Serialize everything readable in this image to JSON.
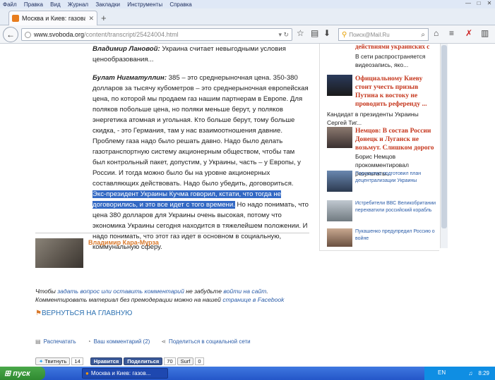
{
  "window": {
    "menu": [
      "Файл",
      "Правка",
      "Вид",
      "Журнал",
      "Закладки",
      "Инструменты",
      "Справка"
    ]
  },
  "tab": {
    "title": "Москва и Киев: газовая война ..."
  },
  "address": {
    "domain": "www.svoboda.org",
    "path": "/content/transcript/25424004.html"
  },
  "search": {
    "placeholder": "Поиск@Mail.Ru"
  },
  "article": {
    "p1_name": "Владимир Лановой:",
    "p1_text": " Украина считает невыгодными условия ценообразования...",
    "p2_name": "Булат Нигматуллин:",
    "p2_text": " 385 – это среднерыночная цена. 350-380 долларов за тысячу кубометров – это среднерыночная европейская цена, по которой мы продаем газ нашим партнерам в Европе. Для поляков побольше цена, но поляки меньше берут, у поляков энергетика атомная и угольная. Кто больше берут, тому больше скидка, - это Германия, там у нас взаимоотношения давние. Проблему газа надо было решать давно. Надо было делать газотранспортную систему акционерным обществом, чтобы там был контрольный пакет, допустим, у Украины, часть – у Европы, у России. И тогда можно было бы на уровне акционерных составляющих действовать. Надо было убедить, договориться.",
    "p2_highlight": " Экс-президент Украины Кучма говорил, кстати, что тогда не договорились, и это все идет с того времени.",
    "p2_tail": " Но надо понимать, что цена 380 долларов для Украины очень высокая, потому что экономика Украины сегодня находится в тяжелейшем положении. И надо понимать, что этот газ идет в основном в социальную, коммунальную сферу.",
    "author": "Владимир Кара-Мурза"
  },
  "note": {
    "t1": "Чтобы ",
    "l1": "задать вопрос или оставить комментарий",
    "t2": " не забудьте ",
    "l2": "войти на сайт",
    "t3": ".",
    "t4": "Комментировать материал без премодерации можно на нашей ",
    "l3": "странице в Facebook"
  },
  "back_link": "ВЕРНУТЬСЯ НА ГЛАВНУЮ",
  "actions": [
    "Распечатать",
    "Ваш комментарий (2)",
    "Поделиться в социальной сети"
  ],
  "sidebar": {
    "top_title": "действиями украинских с",
    "top_text": "В сети распространяется видеозапись, яко...",
    "item1_title": "Официальному Киеву стоит учесть призыв Путина к востоку не проводить референду ...",
    "item1_text": "Кандидат в президенты Украины Сергей Тиг...",
    "item2_title": "Немцов: В состав России Донецк и Луганск не возьмут. Слишком дорого",
    "item2_text": "Борис Немцов прокомментировал результаты...",
    "small1": "Порошенко подготовил план децентрализации Украины",
    "small2": "Истребители ВВС Великобритании перехватили российский корабль",
    "small3": "Пукашенко предупредил Россию о войне"
  },
  "social": {
    "tweet": "Твитнуть",
    "tweet_count": "14",
    "like": "Нравится",
    "share": "Поделиться",
    "share_count": "70",
    "surf": "Surf",
    "surf_count": "0"
  },
  "taskbar": {
    "start": "пуск",
    "task": "Москва и Киев: газов...",
    "lang": "EN",
    "clock": "8:29"
  }
}
